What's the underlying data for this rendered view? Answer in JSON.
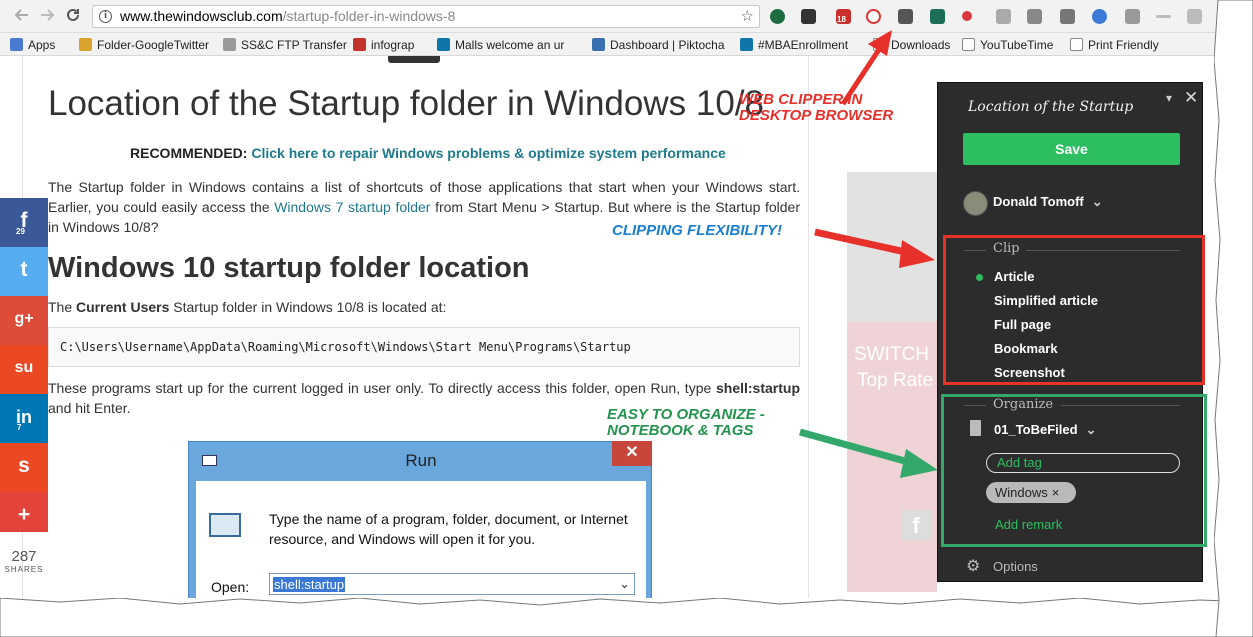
{
  "browser": {
    "url_domain": "www.thewindowsclub.com",
    "url_path": "/startup-folder-in-windows-8",
    "back_icon": "arrow-left-icon",
    "forward_icon": "arrow-right-icon",
    "reload_icon": "reload-icon",
    "star_icon": "star-icon",
    "extension_badge": "18",
    "bookmarks": [
      {
        "label": "Apps",
        "color": "#4a7bd0"
      },
      {
        "label": "Folder-GoogleTwitter",
        "color": "#d9a32c"
      },
      {
        "label": "SS&C FTP Transfer",
        "color": "#9a9a9a"
      },
      {
        "label": "infograp",
        "color": "#c2342b"
      },
      {
        "label": "Malls welcome an ur",
        "color": "#0e76a8"
      },
      {
        "label": "Dashboard | Piktocha",
        "color": "#3a6fb0"
      },
      {
        "label": "#MBAEnrollment",
        "color": "#0e76a8"
      },
      {
        "label": "Downloads",
        "color": "#888888"
      },
      {
        "label": "YouTubeTime",
        "color": "#888888"
      },
      {
        "label": "Print Friendly",
        "color": "#888888"
      }
    ]
  },
  "article": {
    "title": "Location of the Startup folder in Windows 10/8",
    "recommended_label": "RECOMMENDED:",
    "recommended_link": "Click here to repair Windows problems & optimize system performance",
    "intro_before_link": "The Startup folder in Windows contains a list of shortcuts of those applications that start when your Windows start. Earlier, you could easily access the ",
    "intro_link": "Windows 7 startup folder",
    "intro_after_link": " from Start  Menu > Startup. But where is the Startup folder in Windows 10/8?",
    "heading": "Windows 10 startup folder location",
    "current_users_before": "The ",
    "current_users_bold": "Current Users",
    "current_users_after": " Startup folder in Windows 10/8 is located at:",
    "path_code": "C:\\Users\\Username\\AppData\\Roaming\\Microsoft\\Windows\\Start Menu\\Programs\\Startup",
    "run_text_before": "These programs start up for the current logged in user only. To directly access this folder, open Run, type ",
    "run_text_bold": "shell:startup",
    "run_text_after": " and hit Enter."
  },
  "share": {
    "facebook_count": "29",
    "linkedin_count": "7",
    "total_count": "287",
    "total_label": "SHARES",
    "buttons": [
      {
        "name": "facebook",
        "glyph": "f",
        "color": "#3b5998"
      },
      {
        "name": "twitter",
        "glyph": "t",
        "color": "#55acee"
      },
      {
        "name": "google-plus",
        "glyph": "g+",
        "color": "#dd4b39"
      },
      {
        "name": "stumbleupon",
        "glyph": "su",
        "color": "#eb4924"
      },
      {
        "name": "linkedin",
        "glyph": "in",
        "color": "#0077b5"
      },
      {
        "name": "stumble",
        "glyph": "s",
        "color": "#eb4924"
      },
      {
        "name": "more",
        "glyph": "+",
        "color": "#e3433b"
      }
    ]
  },
  "run_dialog": {
    "title": "Run",
    "message": "Type the name of a program, folder, document, or Internet resource, and Windows will open it for you.",
    "open_label": "Open:",
    "open_value": "shell:startup",
    "close_glyph": "✕"
  },
  "ad": {
    "line1": "SWITCH",
    "line2": "Top Rate"
  },
  "clipper": {
    "title": "Location of the Startup",
    "save_label": "Save",
    "user_name": "Donald Tomoff",
    "clip_section": "Clip",
    "clip_options": [
      "Article",
      "Simplified article",
      "Full page",
      "Bookmark",
      "Screenshot"
    ],
    "selected_option": "Article",
    "organize_section": "Organize",
    "notebook": "01_ToBeFiled",
    "add_tag_placeholder": "Add tag",
    "tag": "Windows",
    "add_remark": "Add remark",
    "options_label": "Options",
    "accent_color": "#2dbe60"
  },
  "annotations": {
    "web_clipper_line1": "WEB CLIPPER IN",
    "web_clipper_line2": "DESKTOP BROWSER",
    "clipping": "CLIPPING FLEXIBILITY!",
    "organize_line1": "EASY TO ORGANIZE -",
    "organize_line2": "NOTEBOOK & TAGS"
  },
  "colors": {
    "annotation_red": "#e8302a",
    "annotation_blue": "#1a7fd0",
    "annotation_green": "#23934e"
  }
}
